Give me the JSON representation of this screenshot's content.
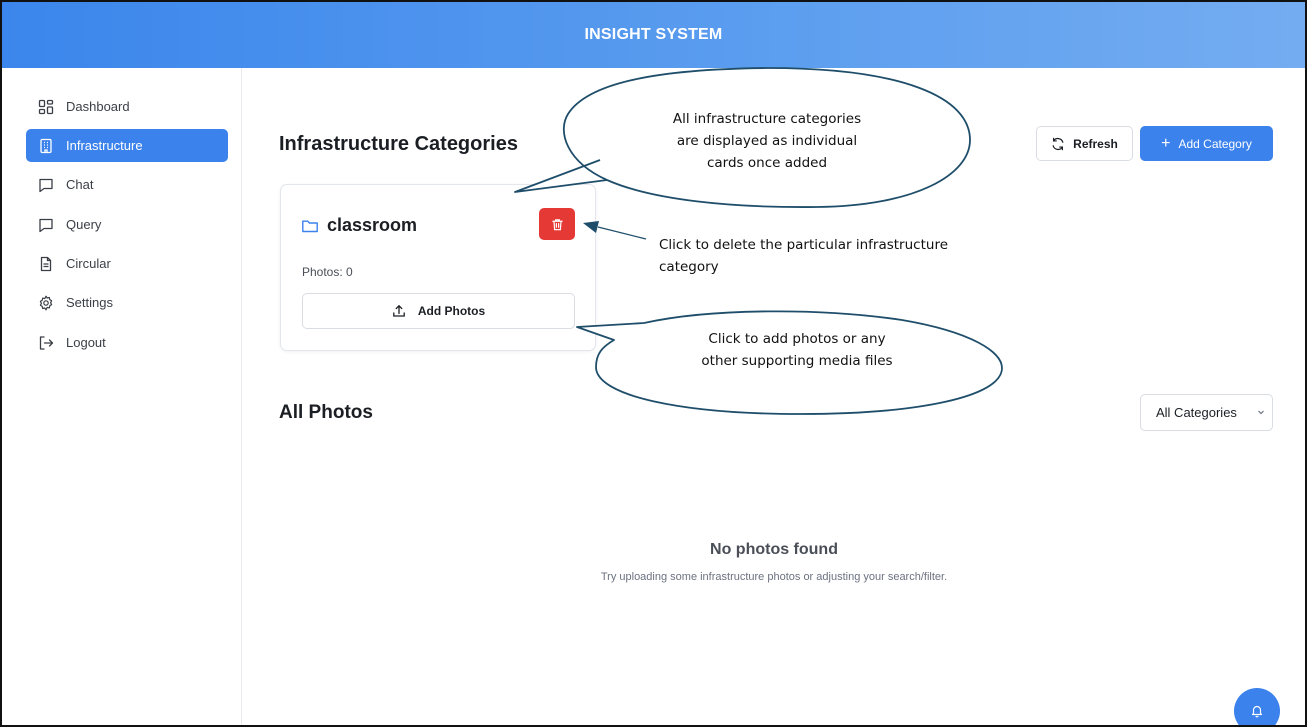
{
  "header": {
    "title": "INSIGHT SYSTEM"
  },
  "sidebar": {
    "items": [
      {
        "label": "Dashboard",
        "icon": "dashboard-grid-icon"
      },
      {
        "label": "Infrastructure",
        "icon": "building-icon",
        "active": true
      },
      {
        "label": "Chat",
        "icon": "chat-bubble-icon"
      },
      {
        "label": "Query",
        "icon": "chat-bubble-icon"
      },
      {
        "label": "Circular",
        "icon": "document-icon"
      },
      {
        "label": "Settings",
        "icon": "gear-icon"
      },
      {
        "label": "Logout",
        "icon": "logout-arrow-icon"
      }
    ]
  },
  "main": {
    "page_title": "Infrastructure Categories",
    "refresh_label": "Refresh",
    "add_category_label": "Add Category",
    "card": {
      "title": "classroom",
      "photos_count": "Photos: 0",
      "add_photos_label": "Add Photos"
    },
    "all_photos_title": "All Photos",
    "filter": {
      "selected": "All Categories"
    },
    "empty": {
      "title": "No photos found",
      "subtitle": "Try uploading some infrastructure photos or adjusting your search/filter."
    }
  },
  "annotations": {
    "cards_line1": "All infrastructure categories",
    "cards_line2": "are displayed as individual",
    "cards_line3": "cards once added",
    "delete_line1": "Click to delete the particular infrastructure",
    "delete_line2": "category",
    "photos_line1": "Click to add photos or any",
    "photos_line2": "other supporting media files"
  },
  "colors": {
    "accent": "#3b82ec",
    "danger": "#e53935",
    "callout_stroke": "#1f4e6b"
  }
}
